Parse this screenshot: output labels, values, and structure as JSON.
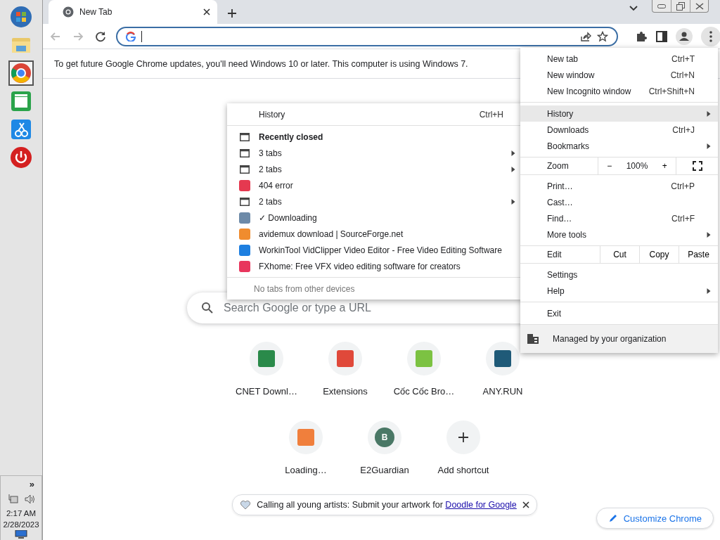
{
  "taskbar": {
    "apps": [
      {
        "kind": "start",
        "selected": false
      },
      {
        "kind": "folder",
        "selected": false
      },
      {
        "kind": "browser",
        "selected": true
      },
      {
        "kind": "calculator",
        "selected": false
      },
      {
        "kind": "paint",
        "selected": false
      },
      {
        "kind": "power",
        "selected": false
      }
    ],
    "tray": {
      "overflow": "»",
      "time": "2:17 AM",
      "date": "2/28/2023"
    }
  },
  "tabs": [
    {
      "title": "New Tab",
      "selected": true
    }
  ],
  "infobar": {
    "text": "To get future Google Chrome updates, you'll need Windows 10 or later. This computer is using Windows 7."
  },
  "search": {
    "placeholder": "Search Google or type a URL"
  },
  "shortcuts": [
    {
      "kind": "site",
      "label": "CNET Downl…",
      "color": "#2a8a4a"
    },
    {
      "kind": "site",
      "label": "Extensions",
      "color": "#e0493a"
    },
    {
      "kind": "site",
      "label": "Cốc Cốc Bro…",
      "color": "#7cc242"
    },
    {
      "kind": "site",
      "label": "ANY.RUN",
      "color": "#1f5a78"
    },
    {
      "kind": "site",
      "label": "Loading…",
      "color": "#f07f3c"
    },
    {
      "kind": "letter",
      "label": "E2Guardian",
      "color": "#4a7866",
      "letter": "B"
    },
    {
      "kind": "add",
      "label": "Add shortcut"
    }
  ],
  "promo": {
    "text": "Calling all young artists: Submit your artwork for ",
    "link": "Doodle for Google"
  },
  "customize_button": "Customize Chrome",
  "menu": {
    "sections": [
      {
        "items": [
          {
            "kind": "item",
            "label": "New tab",
            "shortcut": "Ctrl+T",
            "submenu": false,
            "highlighted": false
          },
          {
            "kind": "item",
            "label": "New window",
            "shortcut": "Ctrl+N",
            "submenu": false,
            "highlighted": false
          },
          {
            "kind": "item",
            "label": "New Incognito window",
            "shortcut": "Ctrl+Shift+N",
            "submenu": false,
            "highlighted": false
          }
        ]
      },
      {
        "items": [
          {
            "kind": "item",
            "label": "History",
            "submenu": true,
            "highlighted": true
          },
          {
            "kind": "item",
            "label": "Downloads",
            "shortcut": "Ctrl+J",
            "submenu": false,
            "highlighted": false
          },
          {
            "kind": "item",
            "label": "Bookmarks",
            "submenu": true,
            "highlighted": false
          }
        ]
      },
      {
        "items": [
          {
            "kind": "zoom",
            "label": "Zoom",
            "minus": "−",
            "value": "100%",
            "plus": "+"
          }
        ]
      },
      {
        "items": [
          {
            "kind": "item",
            "label": "Print…",
            "shortcut": "Ctrl+P",
            "submenu": false,
            "highlighted": false
          },
          {
            "kind": "item",
            "label": "Cast…",
            "submenu": false,
            "highlighted": false
          },
          {
            "kind": "item",
            "label": "Find…",
            "shortcut": "Ctrl+F",
            "submenu": false,
            "highlighted": false
          },
          {
            "kind": "item",
            "label": "More tools",
            "submenu": true,
            "highlighted": false
          }
        ]
      },
      {
        "items": [
          {
            "kind": "edit",
            "label": "Edit",
            "actions": [
              "Cut",
              "Copy",
              "Paste"
            ]
          }
        ]
      },
      {
        "items": [
          {
            "kind": "item",
            "label": "Settings",
            "submenu": false,
            "highlighted": false
          },
          {
            "kind": "item",
            "label": "Help",
            "submenu": true,
            "highlighted": false
          }
        ]
      },
      {
        "items": [
          {
            "kind": "item",
            "label": "Exit",
            "submenu": false,
            "highlighted": false
          }
        ]
      },
      {
        "items": [
          {
            "kind": "managed",
            "label": "Managed by your organization"
          }
        ]
      }
    ]
  },
  "history_menu": {
    "header": {
      "label": "History",
      "shortcut": "Ctrl+H"
    },
    "items": [
      {
        "kind": "heading",
        "label": "Recently closed",
        "submenu": false
      },
      {
        "kind": "tab-group",
        "label": "3 tabs",
        "submenu": true
      },
      {
        "kind": "tab-group",
        "label": "2 tabs",
        "submenu": true
      },
      {
        "kind": "page",
        "label": "404 error",
        "color": "#e53950",
        "submenu": false
      },
      {
        "kind": "tab-group",
        "label": "2 tabs",
        "submenu": true
      },
      {
        "kind": "page",
        "label": "✓ Downloading",
        "color": "#6d8aa8",
        "submenu": false
      },
      {
        "kind": "page",
        "label": "avidemux download | SourceForge.net",
        "color": "#f08c2e",
        "submenu": false
      },
      {
        "kind": "page",
        "label": "WorkinTool VidClipper Video Editor - Free Video Editing Software",
        "color": "#1e7fe0",
        "submenu": false
      },
      {
        "kind": "page",
        "label": "FXhome: Free VFX  video editing software for creators",
        "color": "#e8365d",
        "submenu": false
      }
    ],
    "footer": "No tabs from other devices"
  }
}
